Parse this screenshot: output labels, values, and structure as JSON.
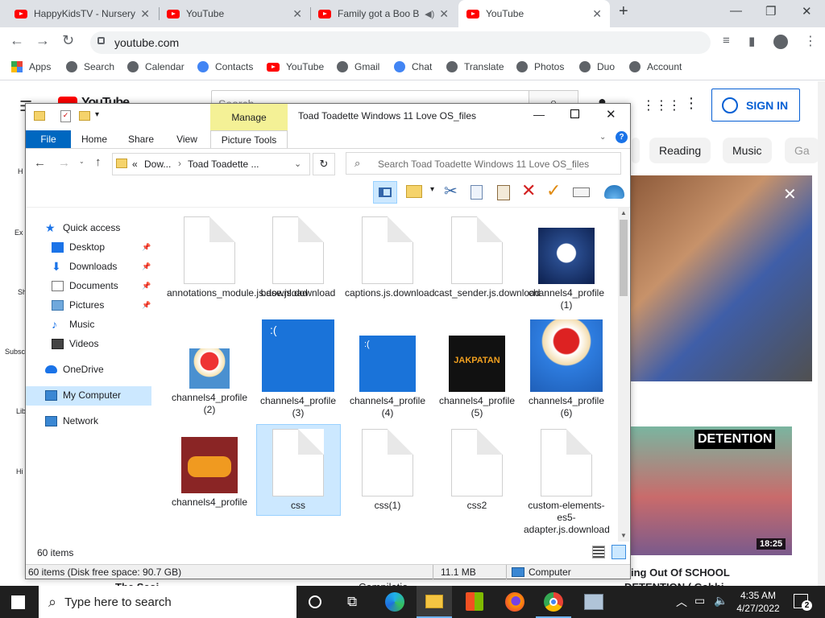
{
  "tabs": [
    {
      "title": "HappyKidsTV - Nursery"
    },
    {
      "title": "YouTube"
    },
    {
      "title": "Family got a Boo B"
    },
    {
      "title": "YouTube"
    }
  ],
  "address": {
    "url": "youtube.com"
  },
  "bookmarks": [
    "Apps",
    "Search",
    "Calendar",
    "Contacts",
    "YouTube",
    "Gmail",
    "Chat",
    "Translate",
    "Photos",
    "Duo",
    "Account"
  ],
  "youtube": {
    "logo": "YouTube",
    "search_placeholder": "Search",
    "sign_in": "SIGN IN",
    "chips": [
      "Reading",
      "Music",
      "Ga"
    ],
    "sidebar": [
      "H",
      "Ex",
      "Sh",
      "Subsc",
      "Lib",
      "Hi"
    ],
    "video_title": "ing Out Of SCHOOL",
    "detention_label": "DETENTION",
    "duration": "18:25",
    "bottom_text_1": "The Scoi",
    "bottom_text_2": "Compilatio",
    "bottom_text_3": "DETENTION ( Gabbi"
  },
  "explorer": {
    "title": "Toad Toadette Windows 11 Love OS_files",
    "ribbon": {
      "file": "File",
      "home": "Home",
      "share": "Share",
      "view": "View",
      "manage": "Manage",
      "picture_tools": "Picture Tools"
    },
    "breadcrumb": {
      "prefix": "«",
      "part1": "Dow...",
      "part2": "Toad Toadette ..."
    },
    "search_placeholder": "Search Toad Toadette Windows 11 Love OS_files",
    "nav": [
      {
        "label": "Quick access"
      },
      {
        "label": "Desktop"
      },
      {
        "label": "Downloads"
      },
      {
        "label": "Documents"
      },
      {
        "label": "Pictures"
      },
      {
        "label": "Music"
      },
      {
        "label": "Videos"
      },
      {
        "label": "OneDrive"
      },
      {
        "label": "My Computer"
      },
      {
        "label": "Network"
      }
    ],
    "files": [
      {
        "name": "annotations_module.js.download",
        "kind": "doc"
      },
      {
        "name": "base.js.download",
        "kind": "doc"
      },
      {
        "name": "captions.js.download",
        "kind": "doc"
      },
      {
        "name": "cast_sender.js.download",
        "kind": "doc"
      },
      {
        "name": "channels4_profile (1)",
        "kind": "baby"
      },
      {
        "name": "channels4_profile (2)",
        "kind": "toad"
      },
      {
        "name": "channels4_profile (3)",
        "kind": "bsod"
      },
      {
        "name": "channels4_profile (4)",
        "kind": "bsod"
      },
      {
        "name": "channels4_profile (5)",
        "kind": "logo"
      },
      {
        "name": "channels4_profile (6)",
        "kind": "toad"
      },
      {
        "name": "channels4_profile",
        "kind": "block"
      },
      {
        "name": "css",
        "kind": "doc"
      },
      {
        "name": "css(1)",
        "kind": "doc"
      },
      {
        "name": "css2",
        "kind": "doc"
      },
      {
        "name": "custom-elements-es5-adapter.js.download",
        "kind": "doc"
      }
    ],
    "status_count": "60 items",
    "details_left": "60 items (Disk free space: 90.7 GB)",
    "details_size": "11.1 MB",
    "details_location": "Computer",
    "logo_text": "JAKPATAN"
  },
  "taskbar": {
    "search_placeholder": "Type here to search",
    "time": "4:35 AM",
    "date": "4/27/2022",
    "notif_count": "2"
  },
  "colors": {
    "accent": "#0067c0",
    "manage_tab": "#f4f196",
    "selection": "#cce8ff"
  }
}
